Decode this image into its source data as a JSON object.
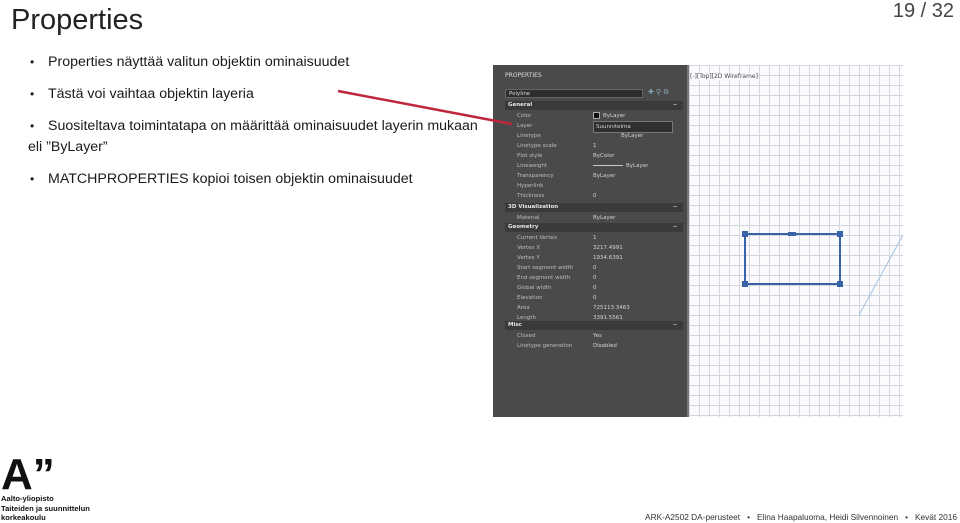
{
  "slide": {
    "title": "Properties",
    "page_number": "19 / 32",
    "bullets": [
      "Properties näyttää valitun objektin ominaisuudet",
      "Tästä voi vaihtaa objektin layeria",
      "Suositeltava toimintatapa on määrittää ominaisuudet layerin mukaan eli ”ByLayer”",
      "MATCHPROPERTIES kopioi toisen objektin ominaisuudet"
    ],
    "accent_color": "#c0263a"
  },
  "screenshot": {
    "panel_title": "PROPERTIES",
    "selection": "Polyline",
    "viewport_label": "[-][Top][2D Wireframe]",
    "sections": [
      {
        "name": "General",
        "rows": [
          {
            "key": "Color",
            "value": "ByLayer"
          },
          {
            "key": "Layer",
            "value": "Suunnitelma"
          },
          {
            "key": "Linetype",
            "value": "ByLayer"
          },
          {
            "key": "Linetype scale",
            "value": "1"
          },
          {
            "key": "Plot style",
            "value": "ByColor"
          },
          {
            "key": "Lineweight",
            "value": "ByLayer"
          },
          {
            "key": "Transparency",
            "value": "ByLayer"
          },
          {
            "key": "Hyperlink",
            "value": ""
          },
          {
            "key": "Thickness",
            "value": "0"
          }
        ]
      },
      {
        "name": "3D Visualization",
        "rows": [
          {
            "key": "Material",
            "value": "ByLayer"
          }
        ]
      },
      {
        "name": "Geometry",
        "rows": [
          {
            "key": "Current Vertex",
            "value": "1"
          },
          {
            "key": "Vertex X",
            "value": "3217.4991"
          },
          {
            "key": "Vertex Y",
            "value": "1934.6391"
          },
          {
            "key": "Start segment width",
            "value": "0"
          },
          {
            "key": "End segment width",
            "value": "0"
          },
          {
            "key": "Global width",
            "value": "0"
          },
          {
            "key": "Elevation",
            "value": "0"
          },
          {
            "key": "Area",
            "value": "725113.3463"
          },
          {
            "key": "Length",
            "value": "3391.5561"
          }
        ]
      },
      {
        "name": "Misc",
        "rows": [
          {
            "key": "Closed",
            "value": "Yes"
          },
          {
            "key": "Linetype generation",
            "value": "Disabled"
          }
        ]
      }
    ]
  },
  "footer": {
    "logo_mark": "A”",
    "logo_lines": [
      "Aalto-yliopisto",
      "Taiteiden ja suunnittelun",
      "korkeakoulu"
    ],
    "course": "ARK-A2502 DA-perusteet",
    "authors": "Elina Haapaluoma, Heidi Silvennoinen",
    "term": "Kevät 2016"
  }
}
